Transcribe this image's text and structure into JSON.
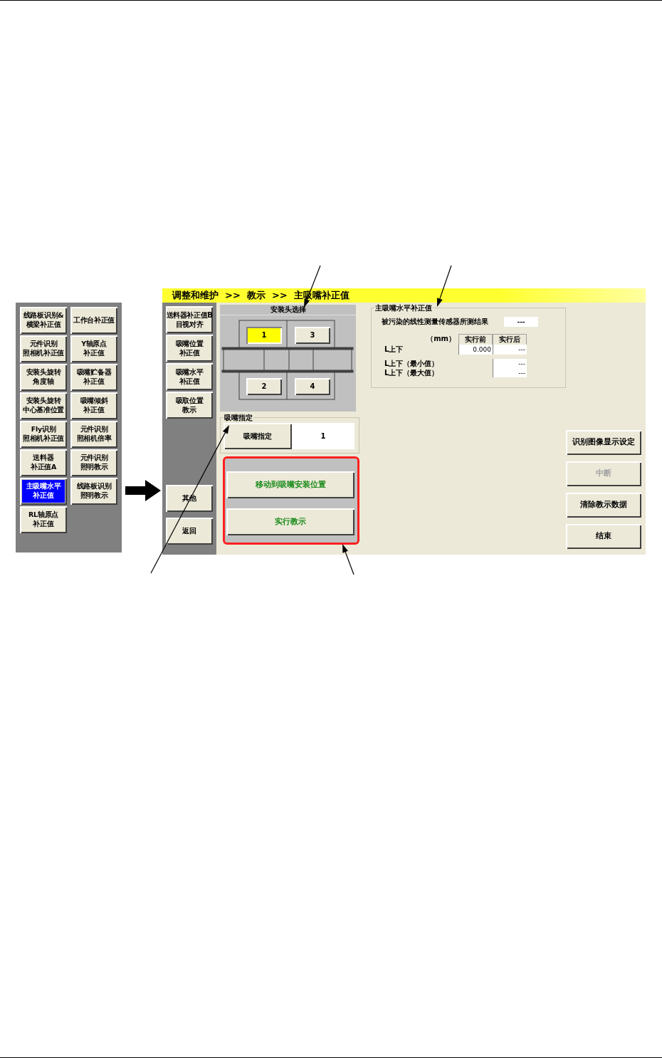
{
  "menu_panel": {
    "buttons": [
      {
        "lines": [
          "线路板识别&",
          "横梁补正值"
        ],
        "selected": false
      },
      {
        "lines": [
          "工作台补正值"
        ],
        "selected": false
      },
      {
        "lines": [
          "元件识别",
          "照相机补正值"
        ],
        "selected": false
      },
      {
        "lines": [
          "Y轴原点",
          "补正值"
        ],
        "selected": false
      },
      {
        "lines": [
          "安装头旋转",
          "角度轴"
        ],
        "selected": false
      },
      {
        "lines": [
          "吸嘴贮备器",
          "补正值"
        ],
        "selected": false
      },
      {
        "lines": [
          "安装头旋转",
          "中心基准位置"
        ],
        "selected": false
      },
      {
        "lines": [
          "吸嘴倾斜",
          "补正值"
        ],
        "selected": false
      },
      {
        "lines": [
          "Fly识别",
          "照相机补正值"
        ],
        "selected": false
      },
      {
        "lines": [
          "元件识别",
          "照相机倍率"
        ],
        "selected": false
      },
      {
        "lines": [
          "送料器",
          "补正值A"
        ],
        "selected": false
      },
      {
        "lines": [
          "元件识别",
          "照明教示"
        ],
        "selected": false
      },
      {
        "lines": [
          "主吸嘴水平",
          "补正值"
        ],
        "selected": true
      },
      {
        "lines": [
          "线路板识别",
          "照明教示"
        ],
        "selected": false
      },
      {
        "lines": [
          "RL轴原点",
          "补正值"
        ],
        "selected": false
      }
    ]
  },
  "screen": {
    "breadcrumb": "调整和维护  >>  教示  >>  主吸嘴补正值",
    "side_buttons": [
      [
        "送料器补正值B",
        "目视对齐"
      ],
      [
        "吸嘴位置",
        "补正值"
      ],
      [
        "吸嘴水平",
        "补正值"
      ],
      [
        "吸取位置",
        "教示"
      ]
    ],
    "side_bottom_buttons": [
      "其他",
      "返回"
    ],
    "head_select": {
      "title": "安装头选择",
      "heads": [
        {
          "label": "1",
          "selected": true
        },
        {
          "label": "3",
          "selected": false
        },
        {
          "label": "2",
          "selected": false
        },
        {
          "label": "4",
          "selected": false
        }
      ]
    },
    "nozzle": {
      "title": "吸嘴指定",
      "button": "吸嘴指定",
      "value": "1"
    },
    "actions": [
      "移动到吸嘴安装位置",
      "实行教示"
    ],
    "correction": {
      "title": "主吸嘴水平补正值",
      "sensor_label": "被污染的线性测量传感器所测结果",
      "sensor_value": "---",
      "unit": "（mm）",
      "columns": [
        "实行前",
        "实行后"
      ],
      "rows": [
        {
          "label": "L上下",
          "values": [
            "0.000",
            "---"
          ]
        }
      ],
      "range_labels": [
        "L上下（最小值）",
        "L上下（最大值）"
      ],
      "range_values": [
        "---",
        "---"
      ]
    },
    "right_buttons": [
      {
        "label": "识别图像显示设定",
        "disabled": false
      },
      {
        "label": "中断",
        "disabled": true
      },
      {
        "label": "清除教示数据",
        "disabled": false
      },
      {
        "label": "结束",
        "disabled": false
      }
    ]
  }
}
